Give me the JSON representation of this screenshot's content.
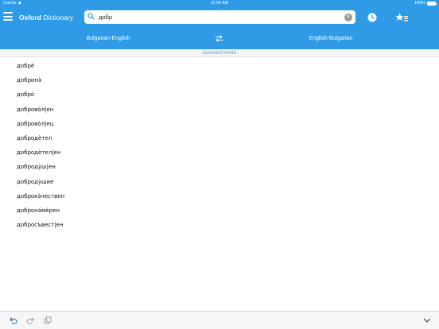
{
  "status_bar": {
    "carrier": "Carrier",
    "time": "11:56 AM",
    "battery": "100%"
  },
  "header": {
    "title_bold": "Oxford",
    "title_rest": " Dictionary"
  },
  "search": {
    "value": "добр",
    "placeholder": ""
  },
  "languages": {
    "left": "Bulgarian-English",
    "right": "English-Bulgarian"
  },
  "suggestions": {
    "heading": "SUGGESTIONS",
    "items": [
      {
        "label": "добрѐ"
      },
      {
        "label": "добрина̀"
      },
      {
        "label": "добро̀"
      },
      {
        "label": "доброво̀л|ен"
      },
      {
        "label": "доброво̀л|ец"
      },
      {
        "label": "добродѐтел"
      },
      {
        "label": "добродѐтел|ен"
      },
      {
        "label": "доброду̀ш|ен"
      },
      {
        "label": "доброду̀шие"
      },
      {
        "label": "доброка̀чествен"
      },
      {
        "label": "доброна́мѐрен"
      },
      {
        "label": "добросъ̀вест|ен"
      }
    ]
  },
  "icons": {
    "menu": "hamburger-menu-icon",
    "search": "search-icon",
    "clear": "clear-icon",
    "history": "clock-icon",
    "favorites": "star-list-icon",
    "swap": "swap-arrows-icon",
    "undo": "undo-icon",
    "redo": "redo-icon",
    "copy": "copy-icon",
    "chevron": "chevron-down-icon"
  },
  "colors": {
    "accent": "#2f9ae6",
    "bottom_bar": "#f6f6f6"
  }
}
